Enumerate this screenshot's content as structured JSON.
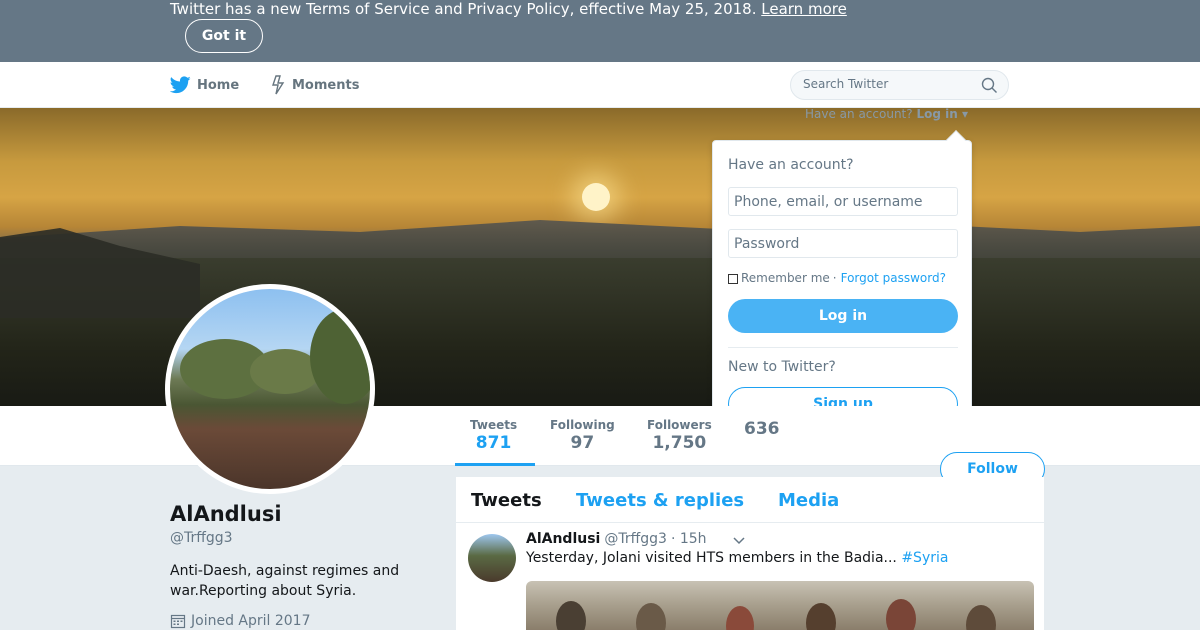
{
  "banner": {
    "text": "Twitter has a new Terms of Service and Privacy Policy, effective May 25, 2018.",
    "link": "Learn more",
    "button": "Got it"
  },
  "nav": {
    "home": "Home",
    "moments": "Moments",
    "search_placeholder": "Search Twitter",
    "login_prompt": "Have an account?",
    "login_link": "Log in"
  },
  "login_dropdown": {
    "title": "Have an account?",
    "username_placeholder": "Phone, email, or username",
    "password_placeholder": "Password",
    "remember": "Remember me",
    "separator": "·",
    "forgot": "Forgot password?",
    "login_button": "Log in",
    "new_prompt": "New to Twitter?",
    "signup_button": "Sign up"
  },
  "profile": {
    "name": "AlAndlusi",
    "handle": "@Trffgg3",
    "bio": "Anti-Daesh, against regimes and war.Reporting about Syria.",
    "joined": "Joined April 2017",
    "follow_button": "Follow",
    "stats": [
      {
        "label": "Tweets",
        "value": "871"
      },
      {
        "label": "Following",
        "value": "97"
      },
      {
        "label": "Followers",
        "value": "1,750"
      },
      {
        "label": "",
        "value": "636"
      }
    ]
  },
  "timeline": {
    "tabs": [
      "Tweets",
      "Tweets & replies",
      "Media"
    ],
    "tweet": {
      "name": "AlAndlusi",
      "handle": "@Trffgg3",
      "time": "· 15h",
      "text": "Yesterday, Jolani visited HTS members in the Badia...",
      "hashtag": "#Syria"
    }
  },
  "colors": {
    "banner_bg": "#657786",
    "accent": "#1da1f2",
    "login_button": "#4ab3f4",
    "page_bg": "#e6ecf0"
  }
}
